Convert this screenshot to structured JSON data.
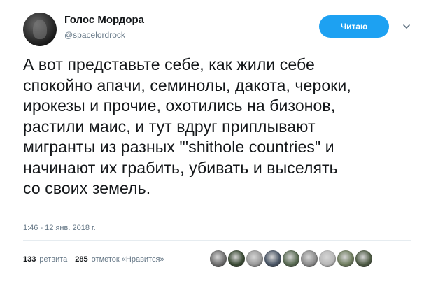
{
  "account": {
    "display_name": "Голос Мордора",
    "handle": "@spacelordrock"
  },
  "follow_button": {
    "label": "Читаю",
    "color": "#1da1f2"
  },
  "menu_icon": "chevron-down-icon",
  "tweet": {
    "text": "А вот представьте себе, как жили себе\nспокойно апачи, семинолы, дакота, чероки,\nирокезы и прочие, охотились на бизонов,\nрастили маис, и тут вдруг приплывают\nмигранты из разных \"'shithole countries\" и\nначинают их грабить, убивать и выселять\nсо своих земель.",
    "timestamp": "1:46 - 12 янв. 2018 г."
  },
  "stats": {
    "retweets_count": "133",
    "retweets_label": "ретвита",
    "likes_count": "285",
    "likes_label": "отметок «Нравится»"
  },
  "likers": [
    {
      "color": "#6e6e6e"
    },
    {
      "color": "#3a4a34"
    },
    {
      "color": "#9a9a9a"
    },
    {
      "color": "#4a5666"
    },
    {
      "color": "#586a52"
    },
    {
      "color": "#8b8b8b"
    },
    {
      "color": "#b8b8b8"
    },
    {
      "color": "#6f7d5e"
    },
    {
      "color": "#4e5b44"
    }
  ],
  "colors": {
    "text": "#14171a",
    "muted": "#657786",
    "divider": "#e6ecf0"
  }
}
